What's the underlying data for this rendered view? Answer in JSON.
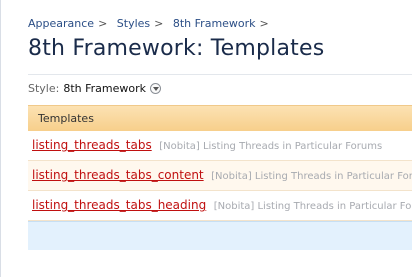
{
  "breadcrumb": [
    "Appearance",
    "Styles",
    "8th Framework"
  ],
  "separator": ">",
  "page": {
    "title": "8th Framework: Templates"
  },
  "style_selector": {
    "label": "Style:",
    "value": "8th Framework"
  },
  "list": {
    "header": "Templates",
    "rows": [
      {
        "name": "listing_threads_tabs",
        "description": "[Nobita] Listing Threads in Particular Forums"
      },
      {
        "name": "listing_threads_tabs_content",
        "description": "[Nobita] Listing Threads in Particular Forums"
      },
      {
        "name": "listing_threads_tabs_heading",
        "description": "[Nobita] Listing Threads in Particular Forums"
      }
    ]
  }
}
